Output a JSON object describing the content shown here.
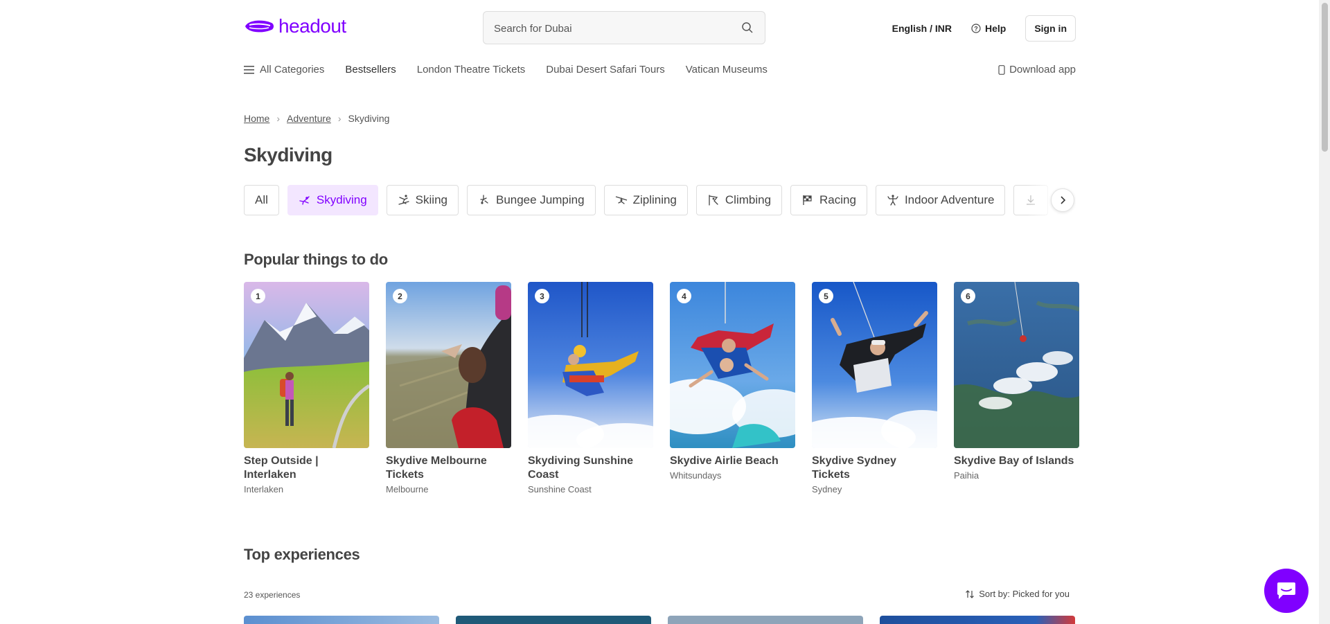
{
  "header": {
    "logo_text": "headout",
    "search_placeholder": "Search for Dubai",
    "language": "English / INR",
    "help": "Help",
    "sign_in": "Sign in"
  },
  "nav": {
    "all_categories": "All Categories",
    "items": [
      "Bestsellers",
      "London Theatre Tickets",
      "Dubai Desert Safari Tours",
      "Vatican Museums"
    ],
    "download_app": "Download app"
  },
  "breadcrumb": {
    "home": "Home",
    "adventure": "Adventure",
    "current": "Skydiving"
  },
  "page_title": "Skydiving",
  "chips": [
    {
      "label": "All",
      "icon": "none",
      "active": false
    },
    {
      "label": "Skydiving",
      "icon": "skydiving-icon",
      "active": true
    },
    {
      "label": "Skiing",
      "icon": "skiing-icon",
      "active": false
    },
    {
      "label": "Bungee Jumping",
      "icon": "bungee-icon",
      "active": false
    },
    {
      "label": "Ziplining",
      "icon": "zipline-icon",
      "active": false
    },
    {
      "label": "Climbing",
      "icon": "climbing-icon",
      "active": false
    },
    {
      "label": "Racing",
      "icon": "racing-flag-icon",
      "active": false
    },
    {
      "label": "Indoor Adventure",
      "icon": "indoor-adventure-icon",
      "active": false
    }
  ],
  "popular": {
    "title": "Popular things to do",
    "cards": [
      {
        "rank": "1",
        "title": "Step Outside | Interlaken",
        "location": "Interlaken"
      },
      {
        "rank": "2",
        "title": "Skydive Melbourne Tickets",
        "location": "Melbourne"
      },
      {
        "rank": "3",
        "title": "Skydiving Sunshine Coast",
        "location": "Sunshine Coast"
      },
      {
        "rank": "4",
        "title": "Skydive Airlie Beach",
        "location": "Whitsundays"
      },
      {
        "rank": "5",
        "title": "Skydive Sydney Tickets",
        "location": "Sydney"
      },
      {
        "rank": "6",
        "title": "Skydive Bay of Islands",
        "location": "Paihia"
      }
    ]
  },
  "top": {
    "title": "Top experiences",
    "count": "23 experiences",
    "sort": "Sort by: Picked for you"
  },
  "colors": {
    "brand": "#8000ff",
    "active_chip_bg": "#f3e6ff"
  }
}
